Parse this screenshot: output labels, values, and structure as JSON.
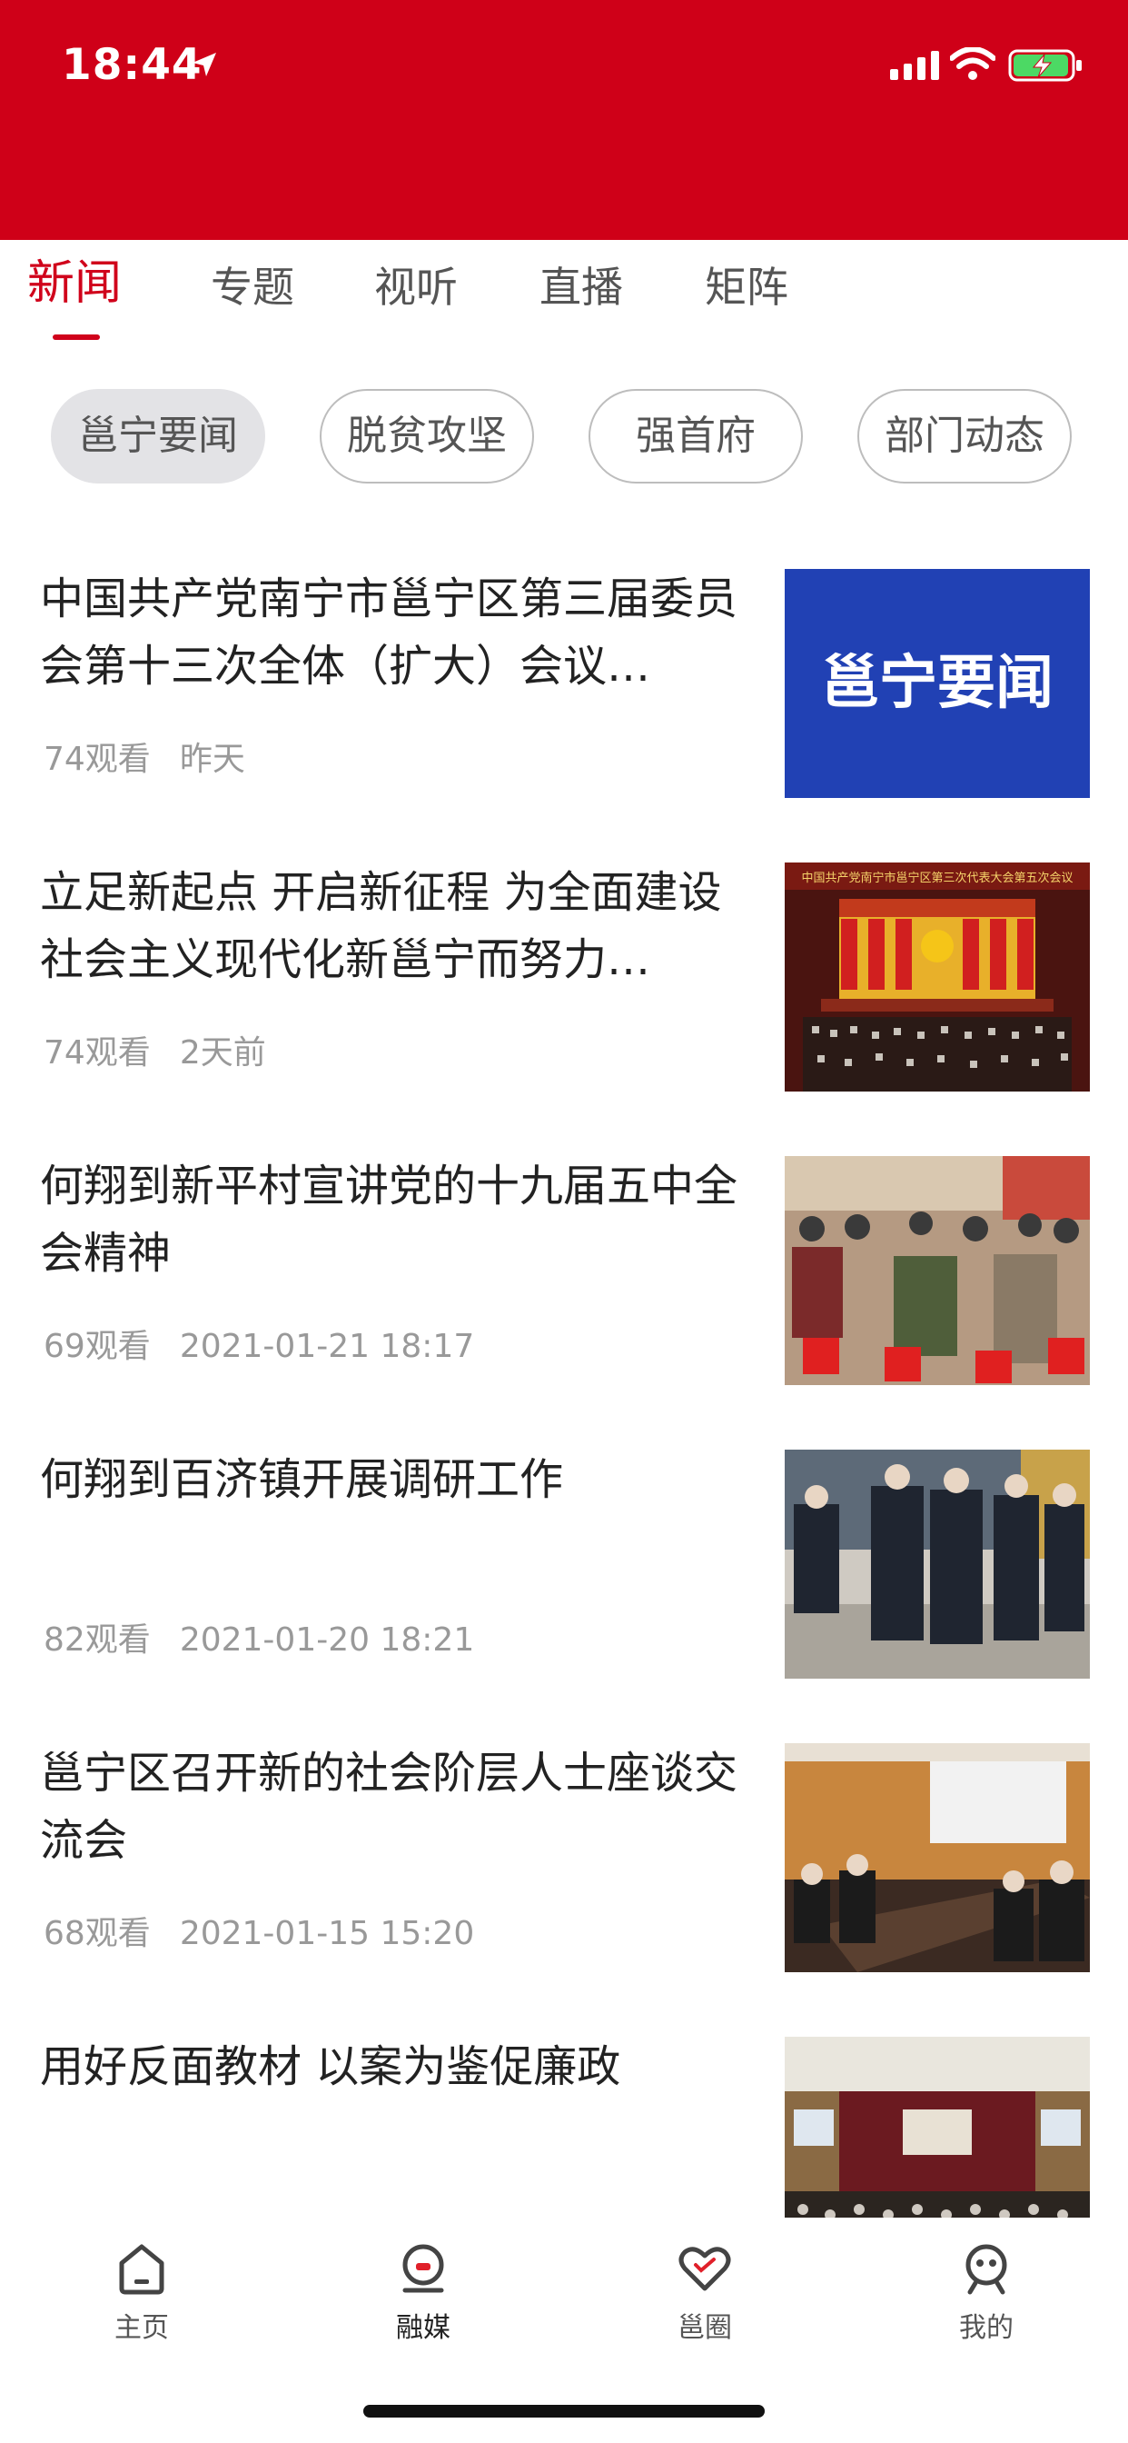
{
  "status_bar": {
    "time": "18:44",
    "background": "#cf0018"
  },
  "tabs": [
    {
      "label": "新闻",
      "active": true
    },
    {
      "label": "专题",
      "active": false
    },
    {
      "label": "视听",
      "active": false
    },
    {
      "label": "直播",
      "active": false
    },
    {
      "label": "矩阵",
      "active": false
    }
  ],
  "chips": [
    {
      "label": "邕宁要闻",
      "active": true
    },
    {
      "label": "脱贫攻坚",
      "active": false
    },
    {
      "label": "强首府",
      "active": false
    },
    {
      "label": "部门动态",
      "active": false
    }
  ],
  "news": [
    {
      "title": "中国共产党南宁市邕宁区第三届委员会第十三次全体（扩大）会议…",
      "views": "74观看",
      "time": "昨天",
      "thumb_label": "邕宁要闻",
      "thumb_type": "text-card"
    },
    {
      "title": "立足新起点 开启新征程 为全面建设社会主义现代化新邕宁而努力…",
      "views": "74观看",
      "time": "2天前",
      "thumb_label": "中国共产党南宁市邕宁区第三次代表大会第五次会议",
      "thumb_type": "congress-hall"
    },
    {
      "title": "何翔到新平村宣讲党的十九届五中全会精神",
      "views": "69观看",
      "time": "2021-01-21 18:17",
      "thumb_type": "village-meeting"
    },
    {
      "title": "何翔到百济镇开展调研工作",
      "views": "82观看",
      "time": "2021-01-20 18:21",
      "thumb_type": "inspection"
    },
    {
      "title": "邕宁区召开新的社会阶层人士座谈交流会",
      "views": "68观看",
      "time": "2021-01-15 15:20",
      "thumb_type": "conference-room"
    },
    {
      "title": "用好反面教材 以案为鉴促廉政",
      "views": "",
      "time": "",
      "thumb_type": "auditorium"
    }
  ],
  "bottom_nav": [
    {
      "label": "主页",
      "icon": "home-icon",
      "active": false
    },
    {
      "label": "融媒",
      "icon": "media-icon",
      "active": true
    },
    {
      "label": "邕圈",
      "icon": "heart-icon",
      "active": false
    },
    {
      "label": "我的",
      "icon": "profile-icon",
      "active": false
    }
  ],
  "colors": {
    "accent": "#d0021b",
    "text": "#222222",
    "muted": "#999999"
  }
}
